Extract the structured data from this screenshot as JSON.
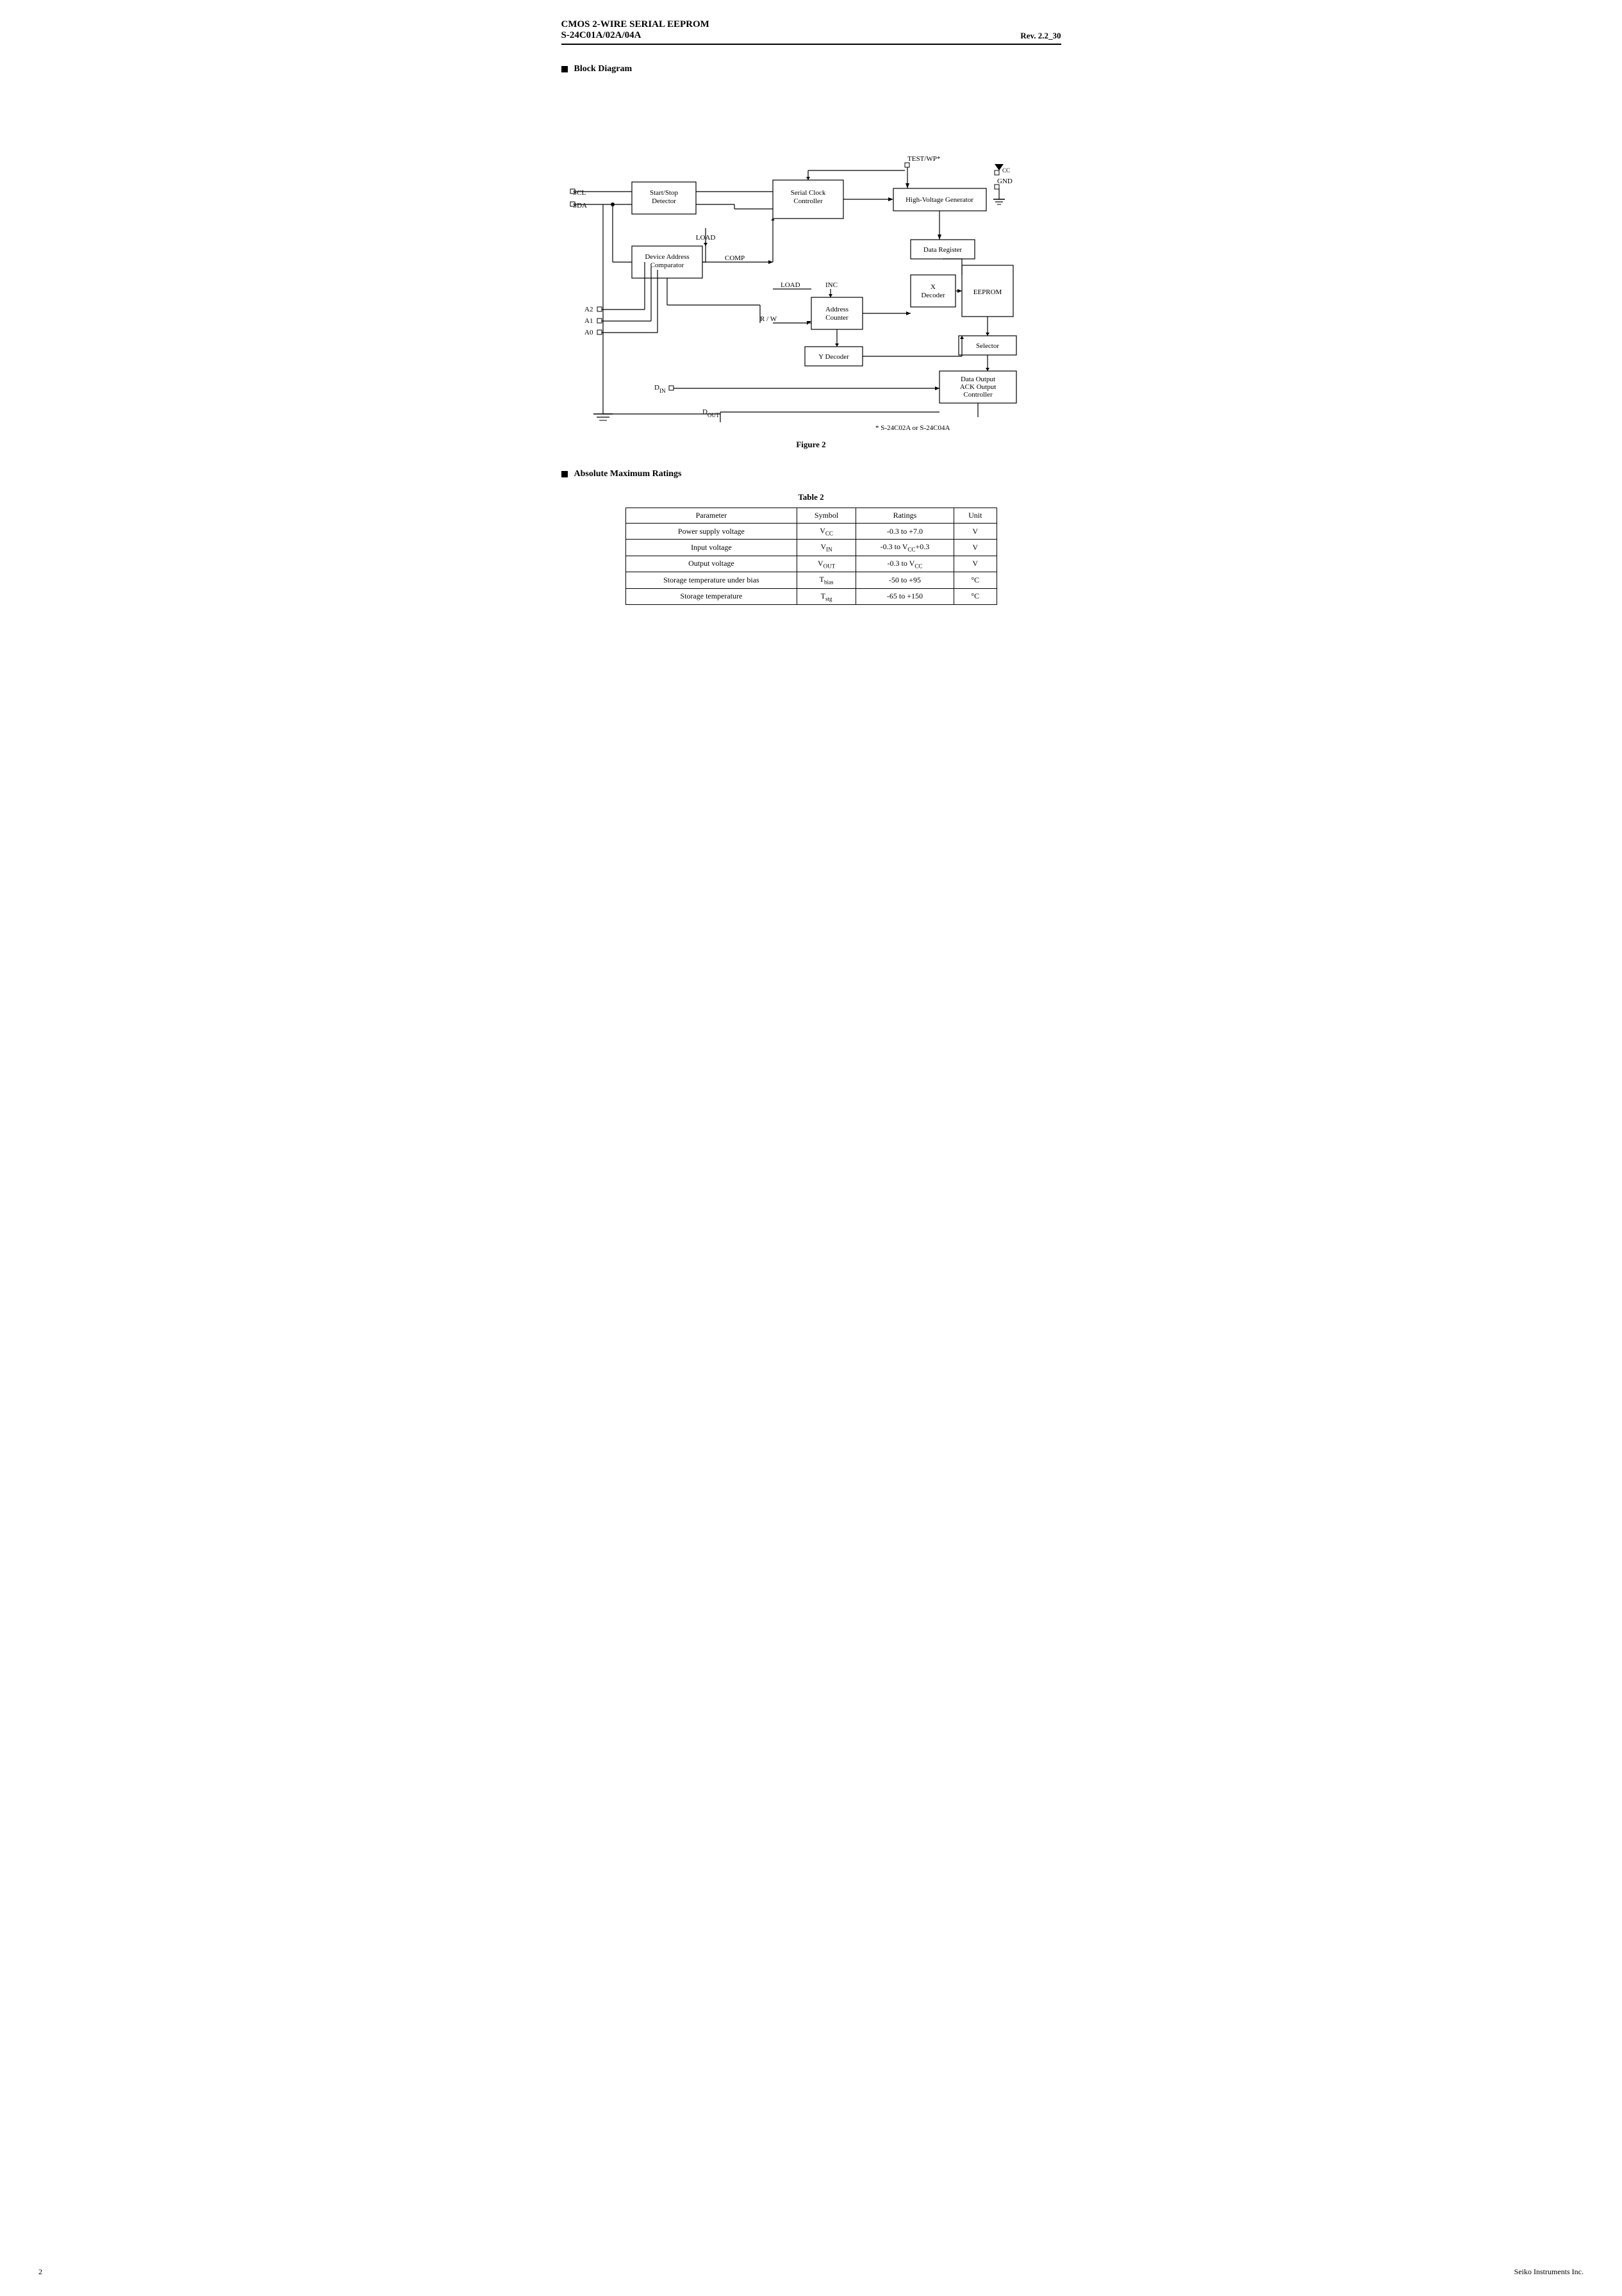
{
  "header": {
    "title_line1": "CMOS 2-WIRE SERIAL  EEPROM",
    "title_line2": "S-24C01A/02A/04A",
    "revision": "Rev. 2.2",
    "page_suffix": "_30"
  },
  "block_diagram": {
    "section_label": "Block Diagram",
    "figure_label": "Figure 2",
    "footnote": "*   S-24C02A or S-24C04A",
    "blocks": {
      "start_stop": "Start/Stop\nDetector",
      "serial_clock": "Serial Clock\nController",
      "high_voltage": "High-Voltage Generator",
      "device_address": "Device Address\nComparator",
      "address_counter": "Address\nCounter",
      "data_register": "Data Register",
      "x_decoder": "X\nDecoder",
      "eeprom": "EEPROM",
      "y_decoder": "Y Decoder",
      "selector": "Selector",
      "data_output": "Data Output\nACK Output\nController"
    },
    "signals": {
      "scl": "SCL",
      "sda": "SDA",
      "a2": "A2",
      "a1": "A1",
      "a0": "A0",
      "din": "D",
      "din_sub": "IN",
      "dout": "D",
      "dout_sub": "OUT",
      "vcc": "V",
      "vcc_sub": "CC",
      "gnd": "GND",
      "load": "LOAD",
      "comp": "COMP",
      "load2": "LOAD",
      "inc": "INC",
      "rw": "R / W",
      "test": "TEST/WP*"
    }
  },
  "table": {
    "title": "Table  2",
    "headers": [
      "Parameter",
      "Symbol",
      "Ratings",
      "Unit"
    ],
    "rows": [
      {
        "parameter": "Power supply voltage",
        "symbol": "V",
        "symbol_sub": "CC",
        "ratings": "-0.3 to +7.0",
        "unit": "V"
      },
      {
        "parameter": "Input voltage",
        "symbol": "V",
        "symbol_sub": "IN",
        "ratings": "-0.3 to V",
        "ratings_sub": "CC",
        "ratings_suffix": "+0.3",
        "unit": "V"
      },
      {
        "parameter": "Output voltage",
        "symbol": "V",
        "symbol_sub": "OUT",
        "ratings": "-0.3 to V",
        "ratings_sub": "CC",
        "unit": "V"
      },
      {
        "parameter": "Storage temperature under bias",
        "symbol": "T",
        "symbol_sub": "bias",
        "ratings": "-50 to +95",
        "unit": "°C"
      },
      {
        "parameter": "Storage temperature",
        "symbol": "T",
        "symbol_sub": "stg",
        "ratings": "-65 to +150",
        "unit": "°C"
      }
    ]
  },
  "footer": {
    "page": "2",
    "company": "Seiko Instruments Inc."
  }
}
